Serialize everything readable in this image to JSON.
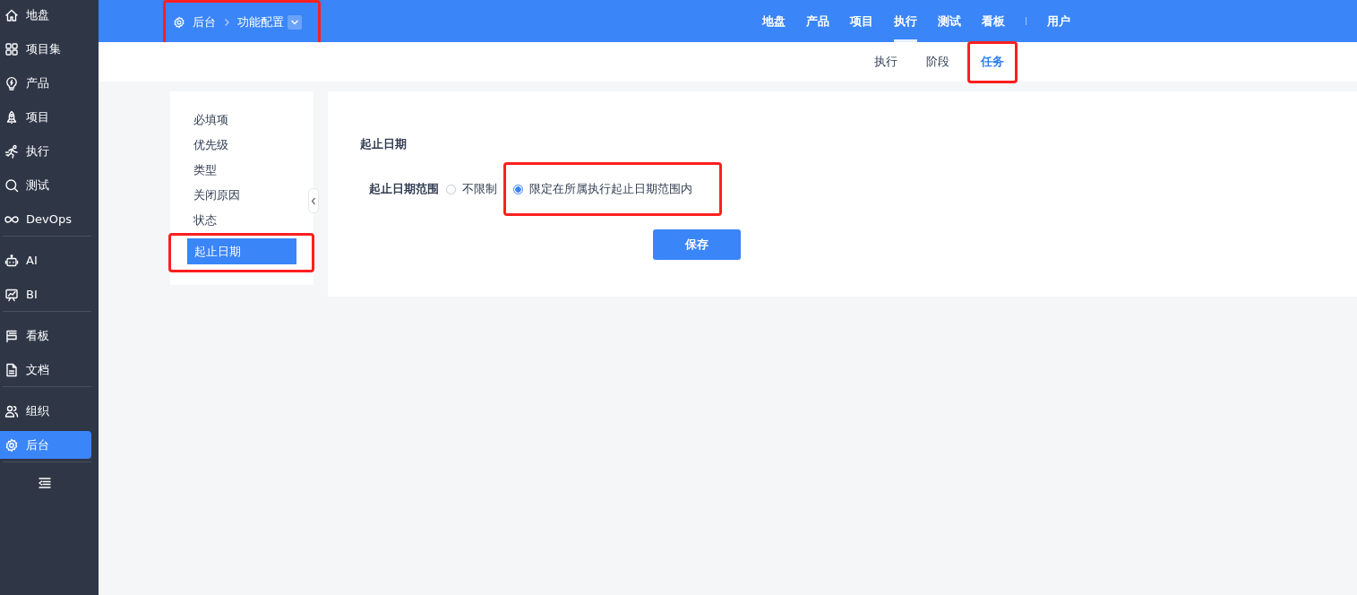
{
  "sidebar": {
    "groups": [
      {
        "items": [
          {
            "label": "地盘",
            "selected": false
          },
          {
            "label": "项目集",
            "selected": false
          },
          {
            "label": "产品",
            "selected": false
          },
          {
            "label": "项目",
            "selected": false
          },
          {
            "label": "执行",
            "selected": false
          },
          {
            "label": "测试",
            "selected": false
          },
          {
            "label": "DevOps",
            "selected": false
          }
        ]
      },
      {
        "items": [
          {
            "label": "AI",
            "selected": false
          },
          {
            "label": "BI",
            "selected": false
          }
        ]
      },
      {
        "items": [
          {
            "label": "看板",
            "selected": false
          },
          {
            "label": "文档",
            "selected": false
          }
        ]
      },
      {
        "items": [
          {
            "label": "组织",
            "selected": false
          },
          {
            "label": "后台",
            "selected": true
          }
        ]
      }
    ]
  },
  "breadcrumb": {
    "highlighted": true,
    "items": [
      "后台",
      "功能配置"
    ]
  },
  "top_nav": {
    "items": [
      {
        "label": "地盘",
        "selected": false
      },
      {
        "label": "产品",
        "selected": false
      },
      {
        "label": "项目",
        "selected": false
      },
      {
        "label": "执行",
        "selected": true
      },
      {
        "label": "测试",
        "selected": false
      },
      {
        "label": "看板",
        "selected": false
      }
    ],
    "extra_items": [
      {
        "label": "用户",
        "selected": false
      }
    ]
  },
  "sub_nav": {
    "items": [
      {
        "label": "执行",
        "selected": false,
        "highlighted": false
      },
      {
        "label": "阶段",
        "selected": false,
        "highlighted": false
      },
      {
        "label": "任务",
        "selected": true,
        "highlighted": true
      }
    ]
  },
  "settings_menu": {
    "items": [
      {
        "label": "必填项",
        "selected": false,
        "highlighted": false
      },
      {
        "label": "优先级",
        "selected": false,
        "highlighted": false
      },
      {
        "label": "类型",
        "selected": false,
        "highlighted": false
      },
      {
        "label": "关闭原因",
        "selected": false,
        "highlighted": false
      },
      {
        "label": "状态",
        "selected": false,
        "highlighted": false
      },
      {
        "label": "起止日期",
        "selected": true,
        "highlighted": true
      }
    ]
  },
  "form": {
    "title": "起止日期",
    "fields": [
      {
        "label": "起止日期范围",
        "options": [
          {
            "label": "不限制",
            "selected": false,
            "highlighted": false
          },
          {
            "label": "限定在所属执行起止日期范围内",
            "selected": true,
            "highlighted": true
          }
        ]
      }
    ],
    "save_button": "保存"
  }
}
